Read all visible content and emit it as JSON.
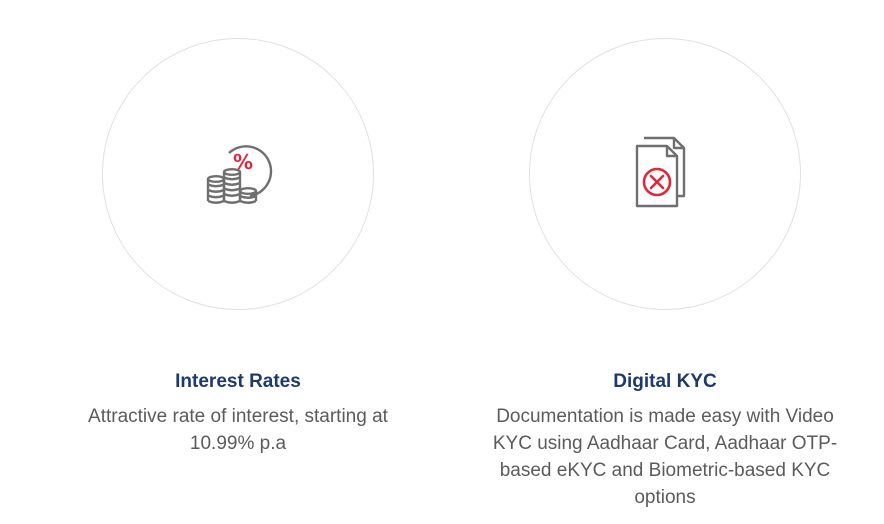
{
  "features": [
    {
      "icon": "coins-percent-icon",
      "title": "Interest Rates",
      "description": "Attractive rate of interest, starting at 10.99% p.a"
    },
    {
      "icon": "document-cross-icon",
      "title": "Digital KYC",
      "description": "Documentation is made easy with Video KYC using Aadhaar Card, Aadhaar OTP-based eKYC and Biometric-based KYC options"
    }
  ],
  "colors": {
    "title": "#1d3a6b",
    "text": "#5b5b5b",
    "icon_gray": "#6f6f6f",
    "icon_red": "#e0283a",
    "circle_border": "#e1e1e1"
  }
}
